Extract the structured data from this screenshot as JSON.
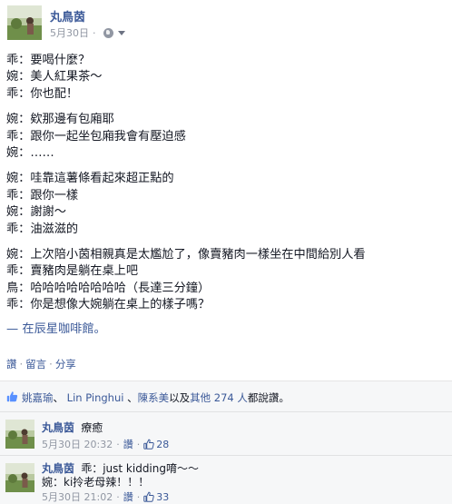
{
  "post": {
    "author": "丸鳥茵",
    "date": "5月30日",
    "lines_group1": [
      "乖：要喝什麼？",
      "婉：美人紅果茶～",
      "乖：你也配！"
    ],
    "lines_group2": [
      "婉：欸那邊有包廂耶",
      "乖：跟你一起坐包廂我會有壓迫感",
      "婉：……"
    ],
    "lines_group3": [
      "婉：哇靠這薯條看起來超正點的",
      "乖：跟你一樣",
      "婉：謝謝～",
      "乖：油滋滋的"
    ],
    "lines_group4": [
      "婉：上次陪小茵相親真是太尷尬了，像賣豬肉一樣坐在中間給別人看",
      "乖：賣豬肉是躺在桌上吧",
      "鳥：哈哈哈哈哈哈哈哈（長達三分鐘）",
      "乖：你是想像大婉躺在桌上的樣子嗎？"
    ],
    "location": "— 在辰星咖啡館。"
  },
  "actions": {
    "like": "讚",
    "comment": "留言",
    "share": "分享",
    "separator": "·"
  },
  "likes": {
    "name1": "姚嘉瑜",
    "sep1": "、",
    "name2": "Lin Pinghui",
    "sep2": "、",
    "name3": "陳系美",
    "middle": "以及",
    "others": "其他 274 人",
    "suffix": "都說讚。"
  },
  "comments": [
    {
      "author": "丸鳥茵",
      "text": "療癒",
      "time": "5月30日 20:32",
      "like_label": "讚",
      "like_count": "28"
    },
    {
      "author": "丸鳥茵",
      "text": "乖：just kidding唷～～",
      "text2": "婉：ki拎老母辣！！！",
      "time": "5月30日 21:02",
      "like_label": "讚",
      "like_count": "33"
    }
  ],
  "icons": {
    "privacy": "globe-icon",
    "dropdown": "chevron-down-icon",
    "like": "thumbs-up-icon"
  },
  "colors": {
    "link": "#3b5998",
    "muted": "#9197a3",
    "text": "#141823",
    "panel": "#f6f7f8"
  }
}
